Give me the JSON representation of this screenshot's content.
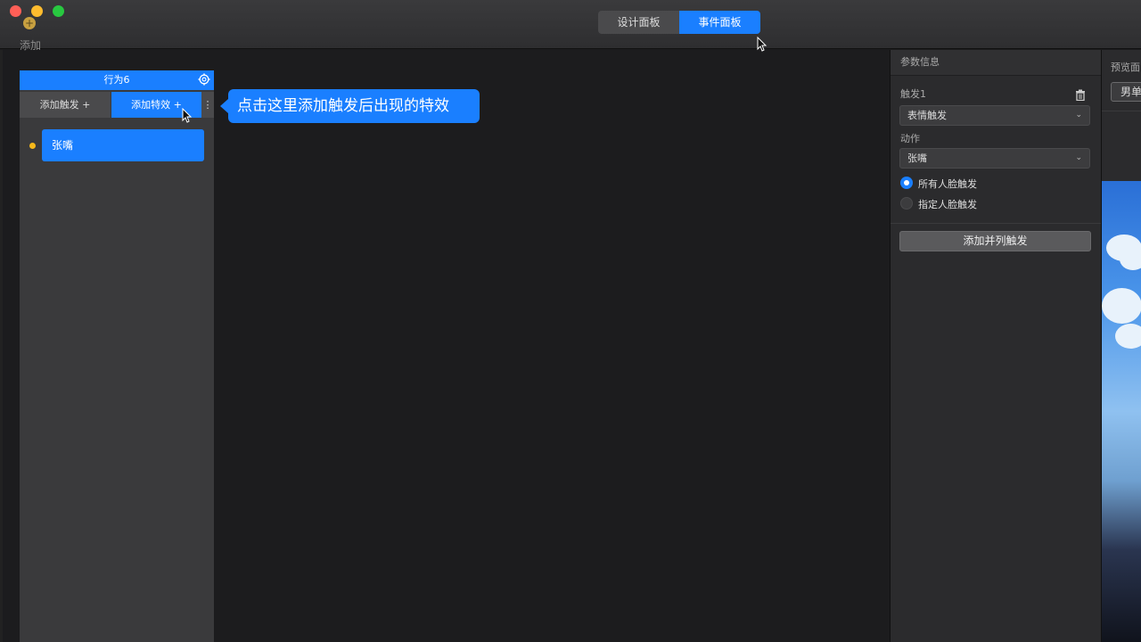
{
  "toolbar": {
    "add_label": "添加",
    "add_icon": "plus-circle-icon"
  },
  "segmented": {
    "design_panel": "设计面板",
    "event_panel": "事件面板",
    "active": "事件面板"
  },
  "behavior_panel": {
    "title": "行为6",
    "tabs": {
      "add_trigger": "添加触发 +",
      "add_effect": "添加特效 +",
      "more": "⋮"
    },
    "items": [
      {
        "label": "张嘴"
      }
    ]
  },
  "tooltip": {
    "text": "点击这里添加触发后出现的特效"
  },
  "params": {
    "header": "参数信息",
    "trigger_label": "触发1",
    "trigger_type": "表情触发",
    "action_label": "动作",
    "action_value": "张嘴",
    "radio_all": "所有人脸触发",
    "radio_specific": "指定人脸触发",
    "selected_radio": "所有人脸触发",
    "add_parallel_button": "添加并列触发"
  },
  "preview": {
    "header": "预览面",
    "button": "男单"
  },
  "colors": {
    "accent": "#1a7fff",
    "background": "#1c1c1e",
    "panel": "#3a3a3c",
    "dot": "#f5b81a"
  }
}
